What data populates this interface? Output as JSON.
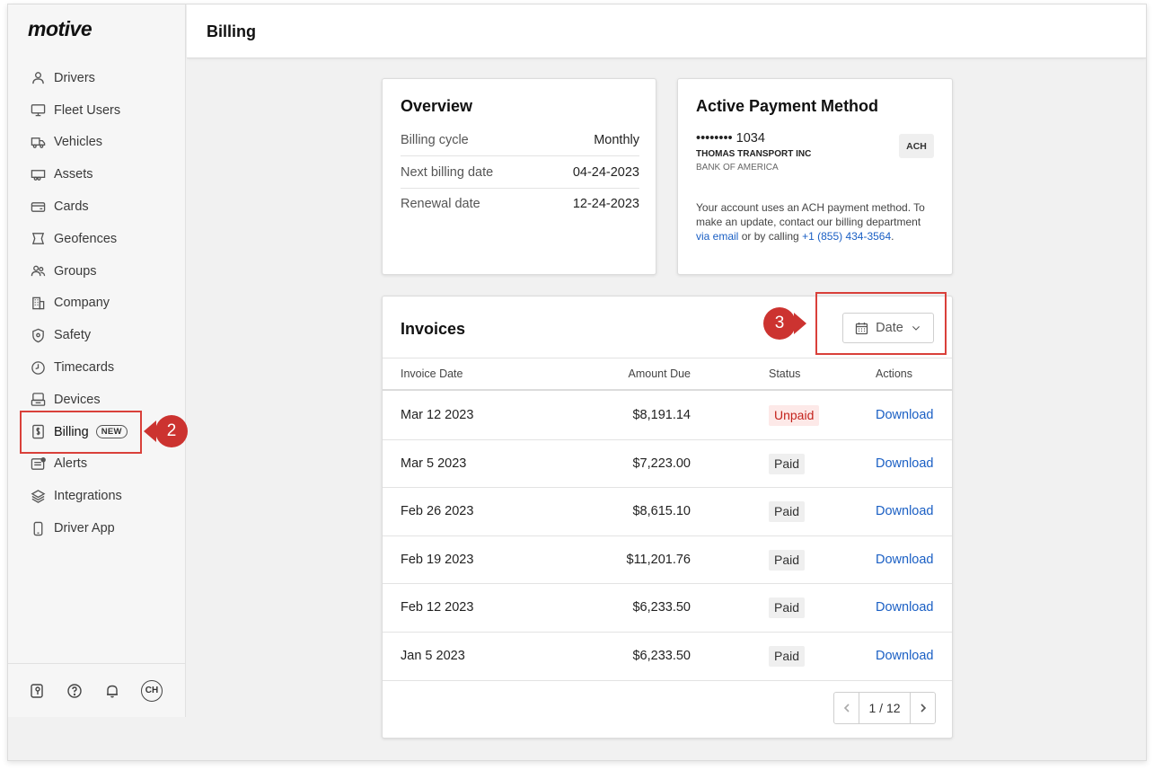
{
  "app": {
    "logo": "motive"
  },
  "header": {
    "title": "Billing"
  },
  "sidebar": {
    "items": [
      {
        "label": "Drivers",
        "icon": "user-icon"
      },
      {
        "label": "Fleet Users",
        "icon": "monitor-icon"
      },
      {
        "label": "Vehicles",
        "icon": "truck-icon"
      },
      {
        "label": "Assets",
        "icon": "trailer-icon"
      },
      {
        "label": "Cards",
        "icon": "card-icon"
      },
      {
        "label": "Geofences",
        "icon": "geofence-icon"
      },
      {
        "label": "Groups",
        "icon": "group-icon"
      },
      {
        "label": "Company",
        "icon": "building-icon"
      },
      {
        "label": "Safety",
        "icon": "shield-icon"
      },
      {
        "label": "Timecards",
        "icon": "clock-icon"
      },
      {
        "label": "Devices",
        "icon": "device-icon"
      },
      {
        "label": "Billing",
        "icon": "billing-icon",
        "badge": "NEW",
        "active": true
      },
      {
        "label": "Alerts",
        "icon": "alert-icon"
      },
      {
        "label": "Integrations",
        "icon": "layers-icon"
      },
      {
        "label": "Driver App",
        "icon": "phone-icon"
      }
    ],
    "footer": {
      "avatar_initials": "CH",
      "icons": [
        "map-pin-icon",
        "help-icon",
        "bell-icon"
      ]
    }
  },
  "annotations": {
    "callout_billing": "2",
    "callout_date": "3",
    "highlight_color": "#d9403a"
  },
  "overview": {
    "title": "Overview",
    "rows": [
      {
        "label": "Billing cycle",
        "value": "Monthly"
      },
      {
        "label": "Next billing date",
        "value": "04-24-2023"
      },
      {
        "label": "Renewal date",
        "value": "12-24-2023"
      }
    ]
  },
  "payment": {
    "title": "Active Payment Method",
    "account_number": "•••••••• 1034",
    "account_name": "THOMAS TRANSPORT INC",
    "bank": "BANK OF AMERICA",
    "method_badge": "ACH",
    "note_prefix": "Your account uses an ACH payment method. To make an update, contact our billing department",
    "note_email_link": "via email",
    "note_middle": "or by calling",
    "note_phone_link": "+1 (855) 434-3564",
    "note_suffix": "."
  },
  "invoices": {
    "title": "Invoices",
    "filter_label": "Date",
    "columns": {
      "date": "Invoice Date",
      "amount": "Amount Due",
      "status": "Status",
      "actions": "Actions"
    },
    "rows": [
      {
        "date": "Mar 12 2023",
        "amount": "$8,191.14",
        "status": "Unpaid",
        "action": "Download"
      },
      {
        "date": "Mar 5 2023",
        "amount": "$7,223.00",
        "status": "Paid",
        "action": "Download"
      },
      {
        "date": "Feb 26 2023",
        "amount": "$8,615.10",
        "status": "Paid",
        "action": "Download"
      },
      {
        "date": "Feb 19 2023",
        "amount": "$11,201.76",
        "status": "Paid",
        "action": "Download"
      },
      {
        "date": "Feb 12 2023",
        "amount": "$6,233.50",
        "status": "Paid",
        "action": "Download"
      },
      {
        "date": "Jan 5 2023",
        "amount": "$6,233.50",
        "status": "Paid",
        "action": "Download"
      }
    ],
    "pagination": {
      "label": "1 / 12"
    }
  }
}
